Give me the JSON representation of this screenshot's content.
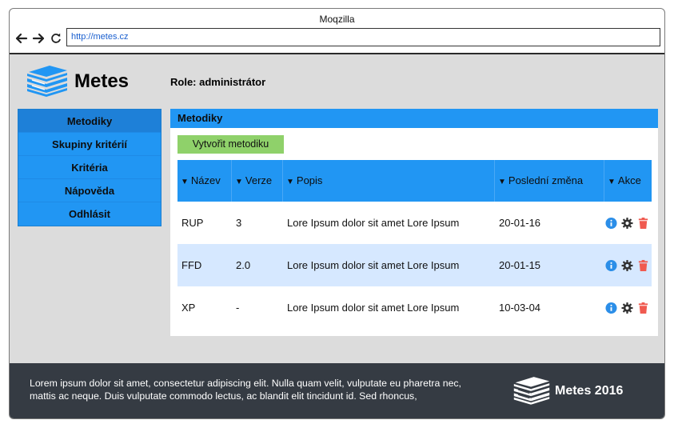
{
  "window": {
    "title": "Moqzilla",
    "url": "http://metes.cz"
  },
  "header": {
    "brand": "Metes",
    "role": "Role: administrátor"
  },
  "sidebar": {
    "items": [
      {
        "label": "Metodiky"
      },
      {
        "label": "Skupiny kritérií"
      },
      {
        "label": "Kritéria"
      },
      {
        "label": "Nápověda"
      },
      {
        "label": "Odhlásit"
      }
    ]
  },
  "panel": {
    "title": "Metodiky",
    "create_label": "Vytvořit metodiku",
    "columns": [
      "Název",
      "Verze",
      "Popis",
      "Poslední změna",
      "Akce"
    ],
    "rows": [
      {
        "name": "RUP",
        "version": "3",
        "description": "Lore Ipsum dolor sit amet Lore Ipsum",
        "changed": "20-01-16"
      },
      {
        "name": "FFD",
        "version": "2.0",
        "description": "Lore Ipsum dolor sit amet Lore Ipsum",
        "changed": "20-01-15"
      },
      {
        "name": "XP",
        "version": "-",
        "description": "Lore Ipsum dolor sit amet Lore Ipsum",
        "changed": "10-03-04"
      }
    ]
  },
  "footer": {
    "text": "Lorem ipsum dolor sit amet, consectetur adipiscing elit. Nulla quam velit, vulputate eu pharetra nec, mattis ac neque. Duis vulputate commodo lectus, ac blandit elit tincidunt id. Sed rhoncus,",
    "brand": "Metes 2016"
  },
  "icons": {
    "back": "arrow-left-icon",
    "forward": "arrow-right-icon",
    "reload": "reload-icon",
    "logo": "books-icon",
    "info": "info-icon",
    "settings": "gear-icon",
    "delete": "trash-icon"
  },
  "colors": {
    "primary": "#2196f3",
    "active_nav": "#1e80d8",
    "create_button": "#8fd16a",
    "row_alt": "#d6e8ff",
    "footer_bg": "#353b43",
    "page_bg": "#dcdcdc",
    "info": "#2b8ee8",
    "delete": "#f05a50"
  }
}
